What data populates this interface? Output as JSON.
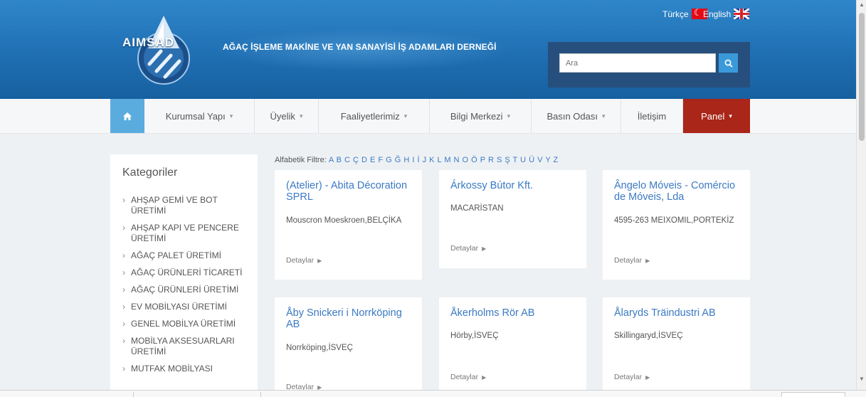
{
  "header": {
    "logo_text": "AIMSAD",
    "association_title": "AĞAÇ İŞLEME MAKİNE VE YAN SANAYİSİ İŞ ADAMLARI DERNEĞİ",
    "languages": [
      {
        "label": "Türkçe",
        "flag": "turkey-flag-icon"
      },
      {
        "label": "English",
        "flag": "uk-flag-icon"
      }
    ],
    "search": {
      "placeholder": "Ara",
      "button_icon": "search-icon"
    }
  },
  "colors": {
    "header_blue": "#1f6fb3",
    "nav_home": "#5aacdf",
    "nav_panel": "#a92618",
    "link_blue": "#3a7ac3"
  },
  "nav": {
    "home_icon": "home-icon",
    "items": [
      {
        "label": "Kurumsal Yapı",
        "dropdown": true
      },
      {
        "label": "Üyelik",
        "dropdown": true
      },
      {
        "label": "Faaliyetlerimiz",
        "dropdown": true
      },
      {
        "label": "Bilgi Merkezi",
        "dropdown": true
      },
      {
        "label": "Basın Odası",
        "dropdown": true
      },
      {
        "label": "İletişim",
        "dropdown": false
      },
      {
        "label": "Panel",
        "dropdown": true
      }
    ]
  },
  "sidebar": {
    "title": "Kategoriler",
    "categories": [
      "AHŞAP GEMİ VE BOT ÜRETİMİ",
      "AHŞAP KAPI VE PENCERE ÜRETİMİ",
      "AĞAÇ PALET ÜRETİMİ",
      "AĞAÇ ÜRÜNLERİ TİCARETİ",
      "AĞAÇ ÜRÜNLERİ ÜRETİMİ",
      "EV MOBİLYASI ÜRETİMİ",
      "GENEL MOBİLYA ÜRETİMİ",
      "MOBİLYA AKSESUARLARI ÜRETİMİ",
      "MUTFAK MOBİLYASI"
    ]
  },
  "filter": {
    "label": "Alfabetik Filtre:",
    "letters": "A B C Ç D E F G Ğ H I İ J K L M N O Ö P R S Ş T U Ü V Y Z"
  },
  "companies": [
    {
      "name": "(Atelier) - Abita Décoration SPRL",
      "location": "Mouscron Moeskroen,BELÇİKA",
      "detail": "Detaylar"
    },
    {
      "name": "Árkossy Bútor Kft.",
      "location": "MACARİSTAN",
      "detail": "Detaylar"
    },
    {
      "name": "Ângelo Móveis - Comércio de Móveis, Lda",
      "location": "4595-263 MEIXOMIL,PORTEKİZ",
      "detail": "Detaylar"
    },
    {
      "name": "Åby Snickeri i Norrköping AB",
      "location": "Norrköping,İSVEÇ",
      "detail": "Detaylar"
    },
    {
      "name": "Åkerholms Rör AB",
      "location": "Hörby,İSVEÇ",
      "detail": "Detaylar"
    },
    {
      "name": "Ålaryds Träindustri AB",
      "location": "Skillingaryd,İSVEÇ",
      "detail": "Detaylar"
    }
  ]
}
